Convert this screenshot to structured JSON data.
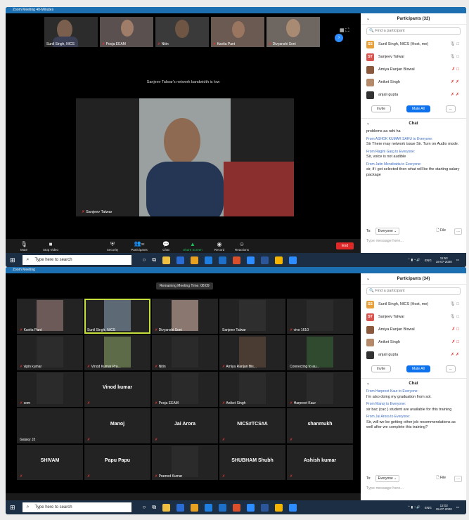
{
  "win1": {
    "title": "Zoom Meeting 40-Minutes",
    "thumbs": [
      {
        "name": "Sunil Singh, NICS"
      },
      {
        "name": "Pooja EEAM"
      },
      {
        "name": "Nitin"
      },
      {
        "name": "Kavita Pant"
      },
      {
        "name": "Divyanshi Soni"
      }
    ],
    "notice": "Sanjeev Talwar's network bandwidth is low",
    "active_speaker": "Sanjeev Talwar",
    "toolbar": [
      {
        "icon": "mic-icon",
        "label": "Mute"
      },
      {
        "icon": "video-icon",
        "label": "Stop Video"
      },
      {
        "icon": "security-icon",
        "label": "Security"
      },
      {
        "icon": "participants-icon",
        "label": "Participants",
        "badge": "32"
      },
      {
        "icon": "chat-icon",
        "label": "Chat"
      },
      {
        "icon": "share-icon",
        "label": "Share Screen"
      },
      {
        "icon": "record-icon",
        "label": "Record"
      },
      {
        "icon": "reactions-icon",
        "label": "Reactions"
      }
    ],
    "end_label": "End",
    "panel": {
      "title": "Participants (32)",
      "search_placeholder": "Find a participant",
      "participants": [
        {
          "initials": "SS",
          "name": "Sunil Singh, NICS (Host, me)",
          "color": "#e8a13a"
        },
        {
          "initials": "ST",
          "name": "Sanjeev Talwar",
          "color": "#d9534f"
        },
        {
          "initials": "",
          "name": "Amiya Ranjan Biswal",
          "color": "#8b5a3c"
        },
        {
          "initials": "",
          "name": "Aniket Singh",
          "color": "#b58a6a"
        },
        {
          "initials": "",
          "name": "anjali gupta",
          "color": "#333333"
        }
      ],
      "invite": "Invite",
      "mute_all": "Mute All",
      "more": "...",
      "chat_title": "Chat",
      "messages": [
        {
          "from": "",
          "text": "problems aa rahi ha"
        },
        {
          "from": "From ASHOK KUMAR SAHU to Everyone:",
          "text": "Sir There may network issue Sir. Turn on Audio mode."
        },
        {
          "from": "From Ragini Garg to Everyone:",
          "text": "Sir, voice is not audible"
        },
        {
          "from": "From Jatin Mendiratta to Everyone:",
          "text": "sir, if i got selected then what will be the starting salary package"
        }
      ],
      "to_label": "To:",
      "to_value": "Everyone",
      "file": "File",
      "type_placeholder": "Type message here..."
    },
    "taskbar": {
      "search": "Type here to search",
      "lang": "ENG",
      "time": "11:53",
      "date": "15-07-2020"
    }
  },
  "win2": {
    "title": "Zoom Meeting",
    "remaining": "Remaining Meeting Time: 08:09",
    "cells": [
      {
        "name": "Kavita Pant",
        "big": "",
        "muted": true,
        "bg": "#6b5a57"
      },
      {
        "name": "Sunil Singh, NICS",
        "big": "",
        "muted": false,
        "bg": "#5d6a75",
        "active": true
      },
      {
        "name": "Divyanshi Soni",
        "big": "",
        "muted": true,
        "bg": "#8a7870"
      },
      {
        "name": "Sanjeev Talwar",
        "big": "",
        "muted": false,
        "bg": "#2e2e2e"
      },
      {
        "name": "vivo 1610",
        "big": "",
        "muted": true,
        "bg": "#2b2b2b"
      },
      {
        "name": "vipin kumar",
        "big": "",
        "muted": true,
        "bg": "#2c2c2c"
      },
      {
        "name": "Vinod Kumar Pra...",
        "big": "",
        "muted": true,
        "bg": "#5e6b48"
      },
      {
        "name": "Nitin",
        "big": "",
        "muted": true,
        "bg": "#2a2a2a"
      },
      {
        "name": "Amiya Ranjan Bis...",
        "big": "",
        "muted": true,
        "bg": "#4a3c33"
      },
      {
        "name": "Connecting to au...",
        "big": "",
        "muted": false,
        "bg": "#2f4a2f"
      },
      {
        "name": "som",
        "big": "",
        "muted": true,
        "bg": "#2b2b2b"
      },
      {
        "name": "",
        "big": "Vinod kumar",
        "muted": true,
        "bg": "#232323"
      },
      {
        "name": "Pooja EEAM",
        "big": "",
        "muted": true,
        "bg": "#2a2a2a"
      },
      {
        "name": "Aniket Singh",
        "big": "",
        "muted": true,
        "bg": "#2b2b2b"
      },
      {
        "name": "Harpreet Kaur",
        "big": "",
        "muted": true,
        "bg": "#2b2b2b"
      },
      {
        "name": "Galaxy J2",
        "big": "",
        "muted": false,
        "bg": "#232323"
      },
      {
        "name": "",
        "big": "Manoj",
        "muted": true,
        "bg": "#232323"
      },
      {
        "name": "",
        "big": "Jai Arora",
        "muted": true,
        "bg": "#232323"
      },
      {
        "name": "",
        "big": "NICS#TCS#A",
        "muted": true,
        "bg": "#232323"
      },
      {
        "name": "",
        "big": "shanmukh",
        "muted": true,
        "bg": "#232323"
      },
      {
        "name": "",
        "big": "SHIVAM",
        "muted": true,
        "bg": "#232323"
      },
      {
        "name": "",
        "big": "Papu Papu",
        "muted": true,
        "bg": "#232323"
      },
      {
        "name": "Pramod Kumar",
        "big": "",
        "muted": true,
        "bg": "#2b2b2b"
      },
      {
        "name": "",
        "big": "SHUBHAM Shubh",
        "muted": true,
        "bg": "#232323"
      },
      {
        "name": "",
        "big": "Ashish kumar",
        "muted": true,
        "bg": "#232323"
      }
    ],
    "panel": {
      "title": "Participants (34)",
      "search_placeholder": "Find a participant",
      "participants": [
        {
          "initials": "SS",
          "name": "Sunil Singh, NICS (Host, me)",
          "color": "#e8a13a"
        },
        {
          "initials": "ST",
          "name": "Sanjeev Talwar",
          "color": "#d9534f"
        },
        {
          "initials": "",
          "name": "Amiya Ranjan Biswal",
          "color": "#8b5a3c"
        },
        {
          "initials": "",
          "name": "Aniket Singh",
          "color": "#b58a6a"
        },
        {
          "initials": "",
          "name": "anjali gupta",
          "color": "#333333"
        }
      ],
      "invite": "Invite",
      "mute_all": "Mute All",
      "more": "...",
      "chat_title": "Chat",
      "messages": [
        {
          "from": "From Harpreet Kaur to Everyone:",
          "text": "I'm also doing my graduation from sol."
        },
        {
          "from": "From Manoj to Everyone:",
          "text": "sir bac (cac ) student are available for this training"
        },
        {
          "from": "From Jai Arora to Everyone:",
          "text": "Sir, will we be getting other job recommendations as well after we complete this training?"
        }
      ],
      "to_label": "To:",
      "to_value": "Everyone",
      "file": "File",
      "type_placeholder": "Type message here..."
    },
    "taskbar": {
      "search": "Type here to search",
      "lang": "ENG",
      "time": "12:02",
      "date": "15-07-2020"
    }
  }
}
